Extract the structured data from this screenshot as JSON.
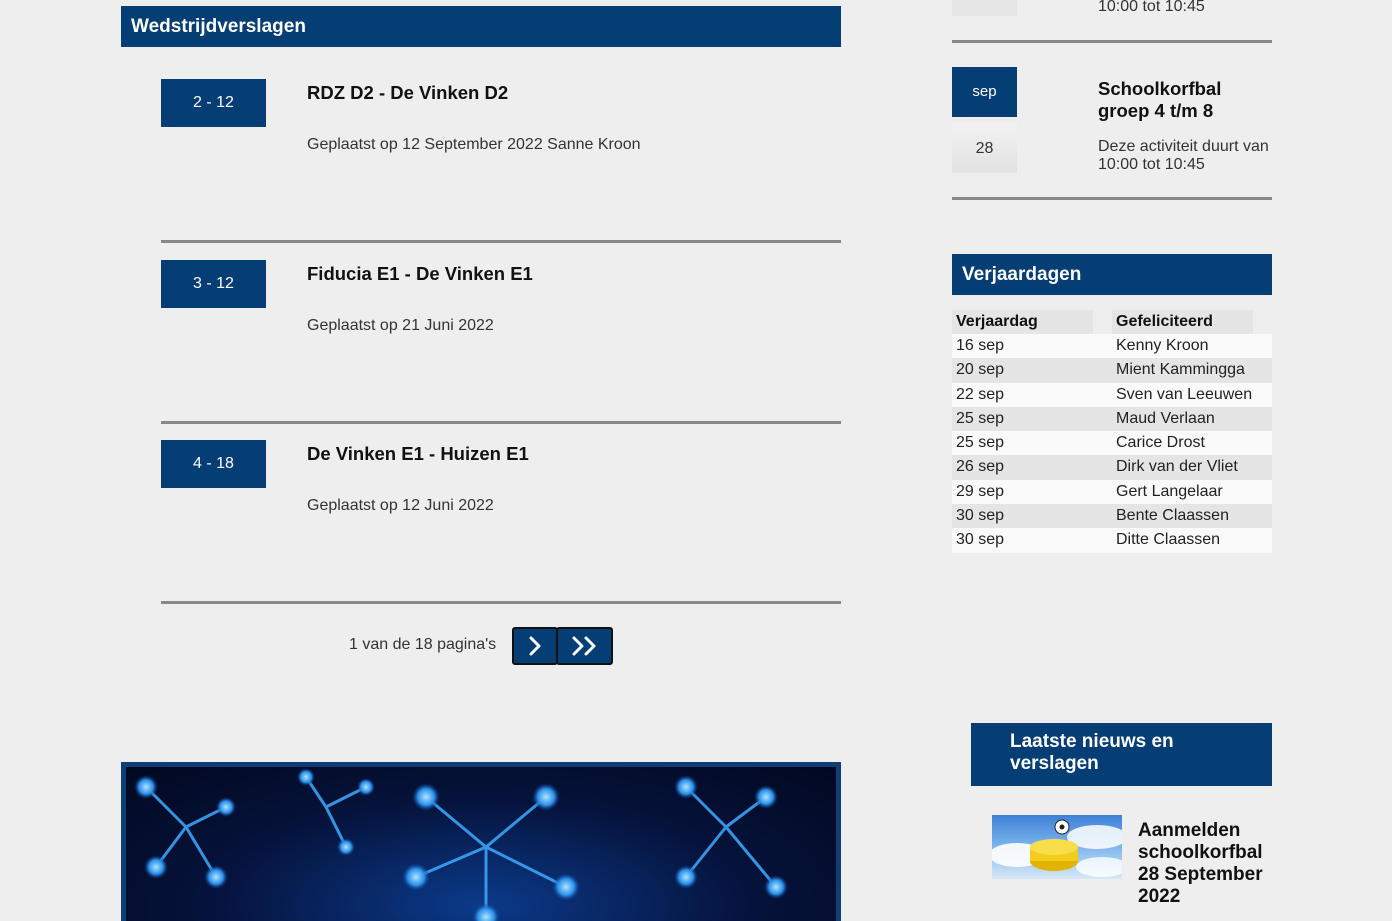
{
  "reports_section": {
    "title": "Wedstrijdverslagen",
    "items": [
      {
        "score": "2 - 12",
        "title": "RDZ D2 - De Vinken D2",
        "meta": "Geplaatst op 12 September 2022 Sanne Kroon"
      },
      {
        "score": "3 - 12",
        "title": "Fiducia E1 - De Vinken E1",
        "meta": "Geplaatst op 21 Juni 2022"
      },
      {
        "score": "4 - 18",
        "title": "De Vinken E1 - Huizen E1",
        "meta": "Geplaatst op 12 Juni 2022"
      }
    ],
    "pager": {
      "text": "1 van de 18 pagina's",
      "next_icon": "chevron-right-icon",
      "last_icon": "double-chevron-right-icon"
    }
  },
  "activities": {
    "previous_tail": "10:00 tot 10:45",
    "event": {
      "month": "sep",
      "day": "28",
      "title": "Schoolkorfbal groep 4 t/m 8",
      "description": "Deze activiteit duurt van 10:00 tot 10:45"
    }
  },
  "birthdays": {
    "title": "Verjaardagen",
    "col_date": "Verjaardag",
    "col_name": "Gefeliciteerd",
    "rows": [
      {
        "date": "16 sep",
        "name": "Kenny Kroon"
      },
      {
        "date": "20 sep",
        "name": "Mient Kammingga"
      },
      {
        "date": "22 sep",
        "name": "Sven van Leeuwen"
      },
      {
        "date": "25 sep",
        "name": "Maud Verlaan"
      },
      {
        "date": "25 sep",
        "name": "Carice Drost"
      },
      {
        "date": "26 sep",
        "name": "Dirk van der Vliet"
      },
      {
        "date": "29 sep",
        "name": "Gert Langelaar"
      },
      {
        "date": "30 sep",
        "name": "Bente Claassen"
      },
      {
        "date": "30 sep",
        "name": "Ditte Claassen"
      }
    ]
  },
  "news": {
    "title": "Laatste nieuws en verslagen",
    "item_title": "Aanmelden schoolkorfbal 28 September 2022"
  },
  "colors": {
    "navy": "#043e74",
    "background": "#eeeeee",
    "separator": "#888888"
  }
}
